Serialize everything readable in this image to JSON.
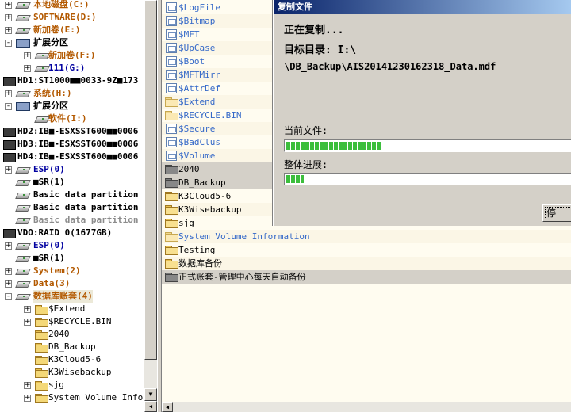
{
  "tree": [
    {
      "label": "本地磁盘(C:)",
      "color": "orange",
      "indent": 1,
      "exp": "+",
      "icon": "drive"
    },
    {
      "label": "SOFTWARE(D:)",
      "color": "orange",
      "indent": 1,
      "exp": "+",
      "icon": "drive"
    },
    {
      "label": "新加卷(E:)",
      "color": "orange",
      "indent": 1,
      "exp": "+",
      "icon": "drive"
    },
    {
      "label": "扩展分区",
      "color": "black",
      "indent": 1,
      "exp": "-",
      "icon": "part"
    },
    {
      "label": "新加卷(F:)",
      "color": "orange",
      "indent": 2,
      "exp": "+",
      "icon": "drive"
    },
    {
      "label": "111(G:)",
      "color": "blue",
      "indent": 2,
      "exp": "+",
      "icon": "drive"
    },
    {
      "label": "HD1:ST1000■■0033-9Z■173",
      "color": "black",
      "indent": 0,
      "exp": "",
      "icon": "hdd"
    },
    {
      "label": "系统(H:)",
      "color": "orange",
      "indent": 1,
      "exp": "+",
      "icon": "drive"
    },
    {
      "label": "扩展分区",
      "color": "black",
      "indent": 1,
      "exp": "-",
      "icon": "part"
    },
    {
      "label": "软件(I:)",
      "color": "orange",
      "indent": 2,
      "exp": "",
      "icon": "drive"
    },
    {
      "label": "HD2:IB■-ESXSST600■■0006",
      "color": "black",
      "indent": 0,
      "exp": "",
      "icon": "hdd"
    },
    {
      "label": "HD3:IB■-ESXSST600■■0006",
      "color": "black",
      "indent": 0,
      "exp": "",
      "icon": "hdd"
    },
    {
      "label": "HD4:IB■-ESXSST600■■0006",
      "color": "black",
      "indent": 0,
      "exp": "",
      "icon": "hdd"
    },
    {
      "label": "ESP(0)",
      "color": "blue",
      "indent": 1,
      "exp": "+",
      "icon": "drive"
    },
    {
      "label": "■SR(1)",
      "color": "black",
      "indent": 1,
      "exp": "",
      "icon": "drive"
    },
    {
      "label": "Basic data partition",
      "color": "black",
      "indent": 1,
      "exp": "",
      "icon": "drive"
    },
    {
      "label": "Basic data partition",
      "color": "black",
      "indent": 1,
      "exp": "",
      "icon": "drive"
    },
    {
      "label": "Basic data partition",
      "color": "gray",
      "indent": 1,
      "exp": "",
      "icon": "drive"
    },
    {
      "label": "VDO:RAID 0(1677GB)",
      "color": "black",
      "indent": 0,
      "exp": "",
      "icon": "hdd"
    },
    {
      "label": "ESP(0)",
      "color": "blue",
      "indent": 1,
      "exp": "+",
      "icon": "drive"
    },
    {
      "label": "■SR(1)",
      "color": "black",
      "indent": 1,
      "exp": "",
      "icon": "drive"
    },
    {
      "label": "System(2)",
      "color": "orange",
      "indent": 1,
      "exp": "+",
      "icon": "drive"
    },
    {
      "label": "Data(3)",
      "color": "orange",
      "indent": 1,
      "exp": "+",
      "icon": "drive"
    },
    {
      "label": "数据库账套(4)",
      "color": "orange",
      "indent": 1,
      "exp": "-",
      "icon": "drive",
      "sel": true
    },
    {
      "label": "$Extend",
      "color": "plain",
      "indent": 2,
      "exp": "+",
      "icon": "folder"
    },
    {
      "label": "$RECYCLE.BIN",
      "color": "plain",
      "indent": 2,
      "exp": "+",
      "icon": "folder"
    },
    {
      "label": "2040",
      "color": "plain",
      "indent": 2,
      "exp": "",
      "icon": "folder"
    },
    {
      "label": "DB_Backup",
      "color": "plain",
      "indent": 2,
      "exp": "",
      "icon": "folder"
    },
    {
      "label": "K3Cloud5-6",
      "color": "plain",
      "indent": 2,
      "exp": "",
      "icon": "folder"
    },
    {
      "label": "K3Wisebackup",
      "color": "plain",
      "indent": 2,
      "exp": "",
      "icon": "folder"
    },
    {
      "label": "sjg",
      "color": "plain",
      "indent": 2,
      "exp": "+",
      "icon": "folder"
    },
    {
      "label": "System Volume Inform",
      "color": "plain",
      "indent": 2,
      "exp": "+",
      "icon": "folder"
    }
  ],
  "files": [
    {
      "name": "$LogFile",
      "kind": "meta"
    },
    {
      "name": "$Bitmap",
      "kind": "meta"
    },
    {
      "name": "$MFT",
      "kind": "meta"
    },
    {
      "name": "$UpCase",
      "kind": "meta"
    },
    {
      "name": "$Boot",
      "kind": "meta"
    },
    {
      "name": "$MFTMirr",
      "kind": "meta"
    },
    {
      "name": "$AttrDef",
      "kind": "meta"
    },
    {
      "name": "$Extend",
      "kind": "metadir"
    },
    {
      "name": "$RECYCLE.BIN",
      "kind": "metadir"
    },
    {
      "name": "$Secure",
      "kind": "meta"
    },
    {
      "name": "$BadClus",
      "kind": "meta"
    },
    {
      "name": "$Volume",
      "kind": "meta"
    },
    {
      "name": "2040",
      "kind": "gray"
    },
    {
      "name": "DB_Backup",
      "kind": "gray"
    },
    {
      "name": "K3Cloud5-6",
      "kind": "yellow"
    },
    {
      "name": "K3Wisebackup",
      "kind": "yellow"
    },
    {
      "name": "sjg",
      "kind": "yellow"
    },
    {
      "name": "System Volume Information",
      "kind": "sysdir"
    },
    {
      "name": "Testing",
      "kind": "yellow"
    },
    {
      "name": "数据库备份",
      "kind": "yellow"
    },
    {
      "name": "正式账套-管理中心每天自动备份",
      "kind": "gray"
    }
  ],
  "dialog": {
    "title": "复制文件",
    "status": "正在复制...",
    "target_label": "目标目录: I:\\",
    "path": "\\DB_Backup\\AIS20141230162318_Data.mdf",
    "current_label": "当前文件:",
    "overall_label": "整体进展:",
    "current_progress": 0.33,
    "overall_progress": 0.06,
    "stop_label": "停"
  }
}
